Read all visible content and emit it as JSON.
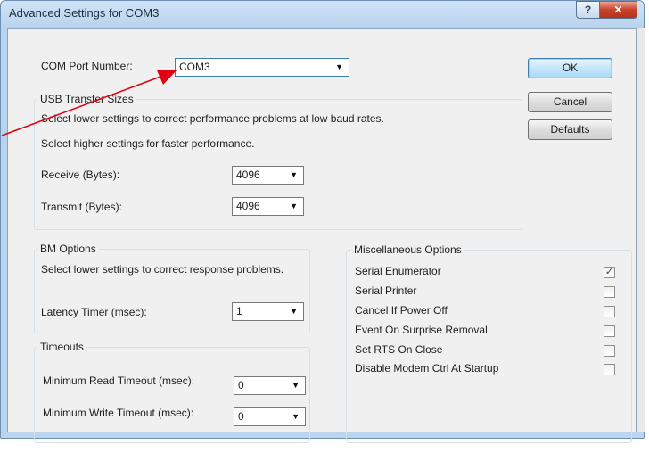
{
  "window": {
    "title": "Advanced Settings for COM3",
    "help_label": "?",
    "close_label": "✕"
  },
  "com_port": {
    "label": "COM Port Number:",
    "value": "COM3"
  },
  "buttons": {
    "ok": "OK",
    "cancel": "Cancel",
    "defaults": "Defaults"
  },
  "usb": {
    "title": "USB Transfer Sizes",
    "hint_low": "Select lower settings to correct performance problems at low baud rates.",
    "hint_high": "Select higher settings for faster performance.",
    "receive_label": "Receive (Bytes):",
    "receive_value": "4096",
    "transmit_label": "Transmit (Bytes):",
    "transmit_value": "4096"
  },
  "bm": {
    "title": "BM Options",
    "hint": "Select lower settings to correct response problems.",
    "latency_label": "Latency Timer (msec):",
    "latency_value": "1"
  },
  "timeouts": {
    "title": "Timeouts",
    "read_label": "Minimum Read Timeout (msec):",
    "read_value": "0",
    "write_label": "Minimum Write Timeout (msec):",
    "write_value": "0"
  },
  "misc": {
    "title": "Miscellaneous Options",
    "items": [
      {
        "label": "Serial Enumerator",
        "checked": true
      },
      {
        "label": "Serial Printer",
        "checked": false
      },
      {
        "label": "Cancel If Power Off",
        "checked": false
      },
      {
        "label": "Event On Surprise Removal",
        "checked": false
      },
      {
        "label": "Set RTS On Close",
        "checked": false
      },
      {
        "label": "Disable Modem Ctrl At Startup",
        "checked": false
      }
    ]
  },
  "colors": {
    "annotation_arrow": "#e0000f",
    "accent_border": "#3c7fb1"
  }
}
